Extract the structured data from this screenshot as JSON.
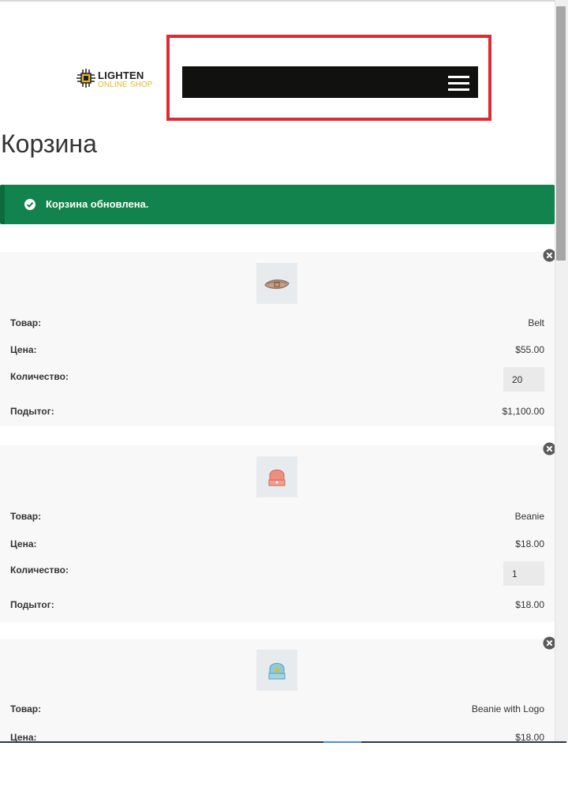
{
  "header": {
    "logo": {
      "line1": "LIGHTEN",
      "line2": "ONLINE SHOP"
    },
    "menu_icon": "hamburger-menu-icon",
    "nav_bar_color": "#111110",
    "highlight_color": "#e02a33"
  },
  "page": {
    "title": "Корзина"
  },
  "notice": {
    "text": "Корзина обновлена.",
    "icon": "check-circle-icon",
    "color": "#12834c"
  },
  "cart": {
    "labels": {
      "product": "Товар:",
      "price": "Цена:",
      "quantity": "Количество:",
      "subtotal": "Подытог:"
    },
    "items": [
      {
        "name": "Belt",
        "price": "$55.00",
        "quantity": "20",
        "subtotal": "$1,100.00",
        "thumb_icon": "belt-icon"
      },
      {
        "name": "Beanie",
        "price": "$18.00",
        "quantity": "1",
        "subtotal": "$18.00",
        "thumb_icon": "beanie-icon"
      },
      {
        "name": "Beanie with Logo",
        "price": "$18.00",
        "quantity": "",
        "subtotal": "",
        "thumb_icon": "beanie-logo-icon"
      }
    ],
    "remove_icon": "remove-circle-icon"
  }
}
